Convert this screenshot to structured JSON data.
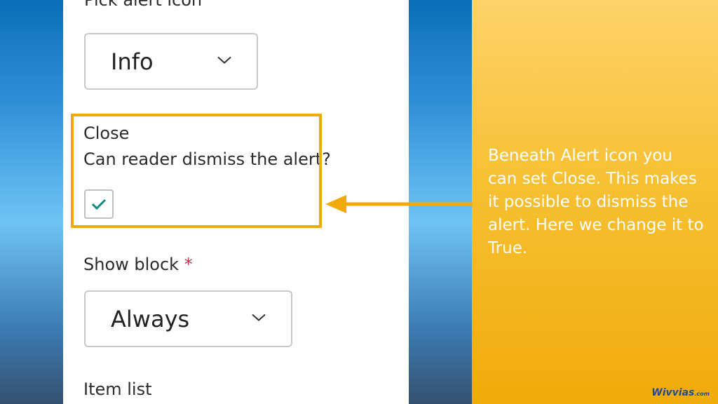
{
  "form": {
    "alert_icon": {
      "label": "Pick alert icon",
      "value": "Info"
    },
    "close": {
      "label": "Close",
      "description": "Can reader dismiss the alert?",
      "checked": true
    },
    "show_block": {
      "label": "Show block",
      "required_mark": "*",
      "value": "Always"
    },
    "item_list": {
      "label": "Item list"
    }
  },
  "callout": {
    "text": "Beneath Alert icon you can set Close. This makes it possible to dismiss the alert. Here we change it to True."
  },
  "logo": {
    "name": "Wivvias",
    "suffix": ".com"
  },
  "colors": {
    "highlight": "#f0ab0a",
    "check": "#0d8a84",
    "callout_text": "#ffffff"
  }
}
